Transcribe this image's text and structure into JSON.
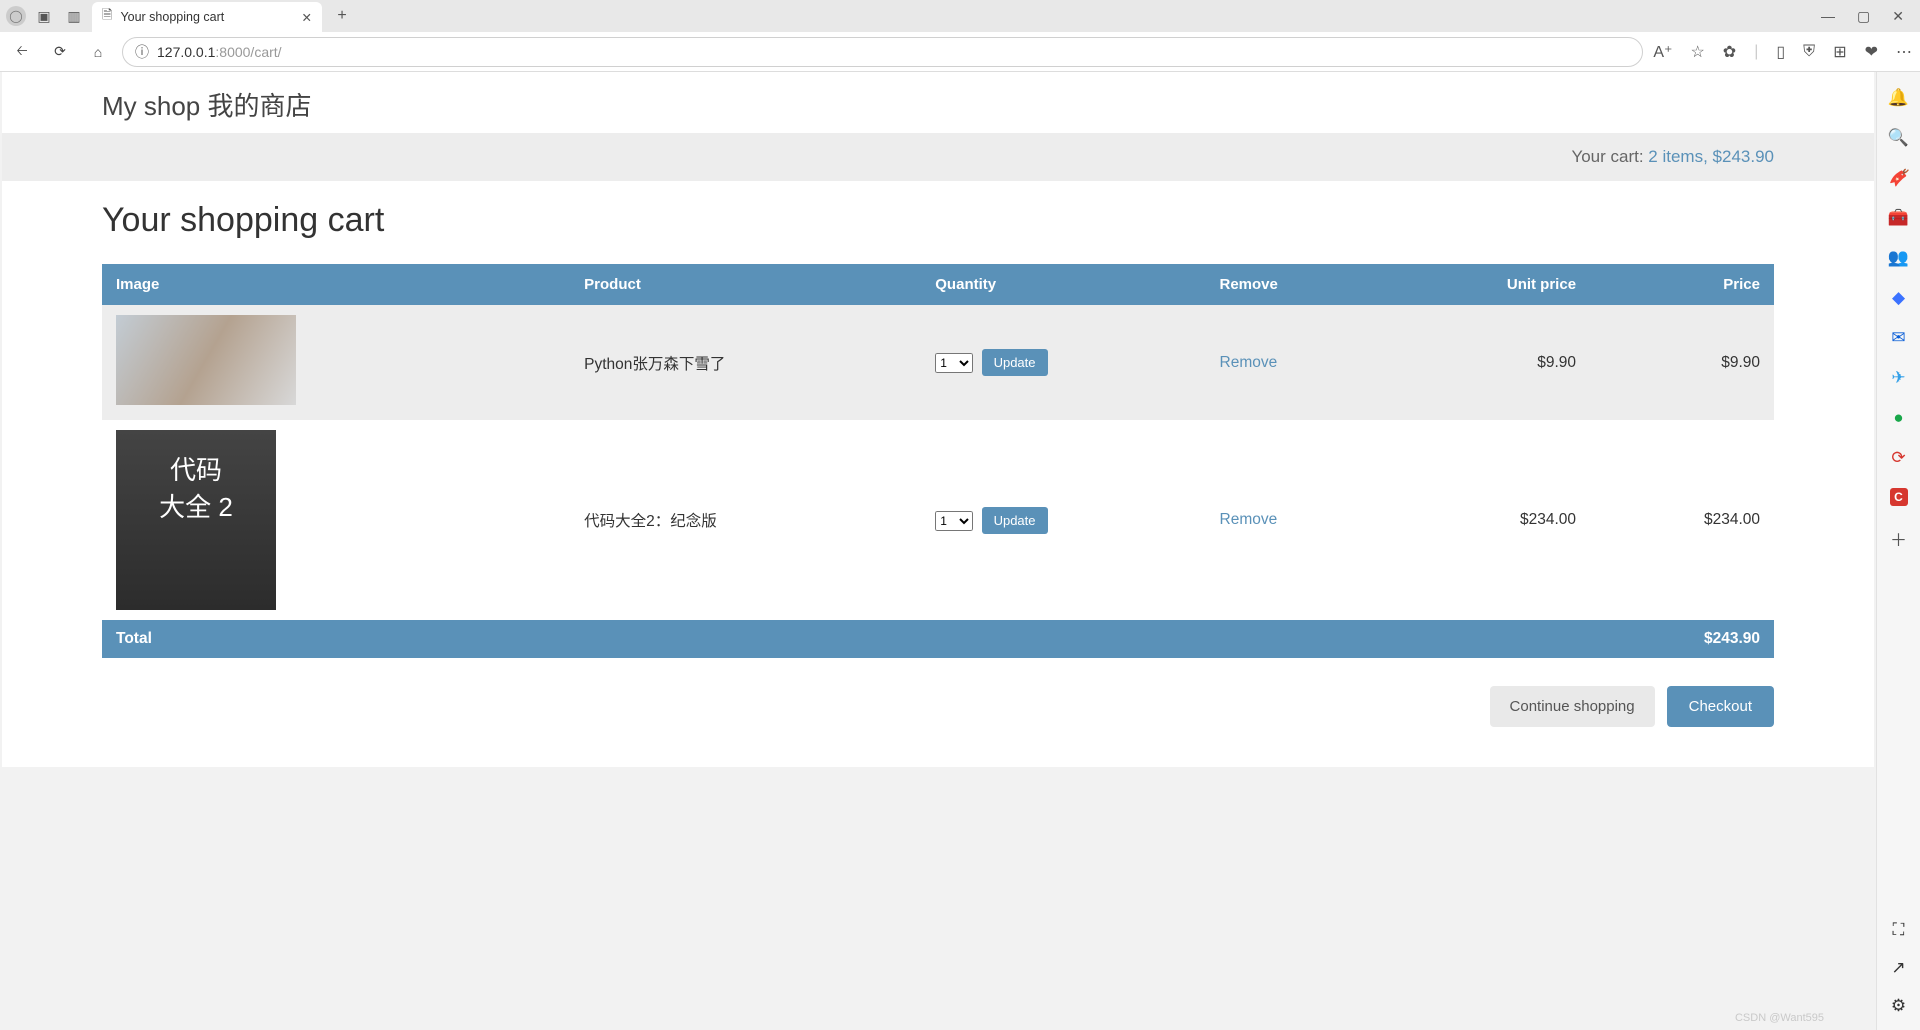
{
  "browser": {
    "tab_title": "Your shopping cart",
    "url_protocol": "127.0.0.1",
    "url_rest": ":8000/cart/",
    "new_tab_glyph": "+",
    "win_minimize": "—",
    "win_maximize": "▢",
    "win_close": "✕"
  },
  "shop": {
    "site_title": "My shop 我的商店",
    "cart_summary_prefix": "Your cart: ",
    "cart_summary_link": "2 items, $243.90",
    "page_heading": "Your shopping cart"
  },
  "table": {
    "headers": {
      "image": "Image",
      "product": "Product",
      "quantity": "Quantity",
      "remove": "Remove",
      "unit_price": "Unit price",
      "price": "Price"
    },
    "rows": [
      {
        "product": "Python张万森下雪了",
        "quantity": "1",
        "update_label": "Update",
        "remove_label": "Remove",
        "unit_price": "$9.90",
        "price": "$9.90"
      },
      {
        "product": "代码大全2：纪念版",
        "quantity": "1",
        "update_label": "Update",
        "remove_label": "Remove",
        "unit_price": "$234.00",
        "price": "$234.00"
      }
    ],
    "total_label": "Total",
    "total_value": "$243.90"
  },
  "actions": {
    "continue_shopping": "Continue shopping",
    "checkout": "Checkout"
  },
  "watermark": "CSDN @Want595"
}
